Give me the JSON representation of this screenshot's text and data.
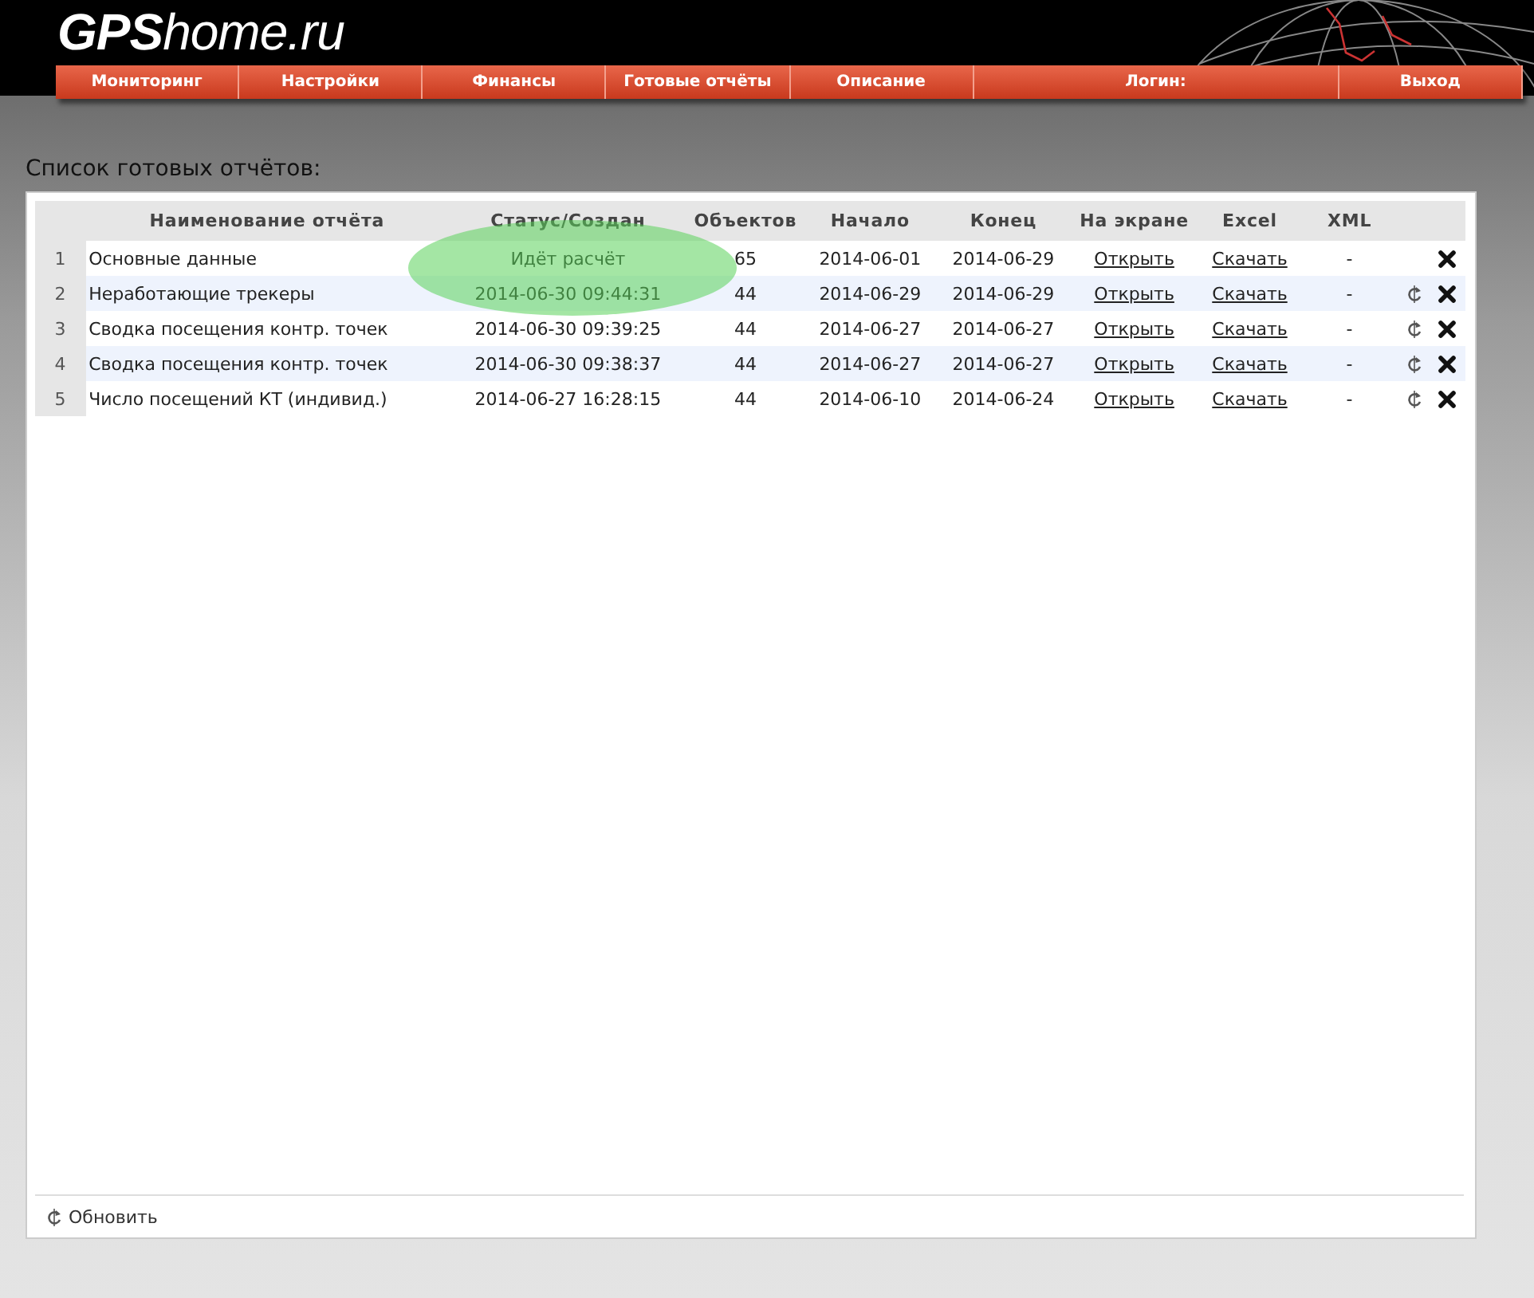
{
  "site": {
    "logo_bold": "GPS",
    "logo_rest": "home.ru"
  },
  "nav": [
    {
      "label": "Мониторинг"
    },
    {
      "label": "Настройки"
    },
    {
      "label": "Финансы"
    },
    {
      "label": "Готовые отчёты"
    },
    {
      "label": "Описание"
    },
    {
      "label": "Логин:",
      "kind": "login"
    },
    {
      "label": "Выход"
    }
  ],
  "page_title": "Список готовых отчётов:",
  "table": {
    "columns": [
      "",
      "Наименование отчёта",
      "Статус/Создан",
      "Объектов",
      "Начало",
      "Конец",
      "На экране",
      "Excel",
      "XML"
    ],
    "rows": [
      {
        "num": "1",
        "name": "Основные данные",
        "status": "Идёт расчёт",
        "objects": "65",
        "start": "2014-06-01",
        "end": "2014-06-29",
        "screen": "Открыть",
        "excel": "Скачать",
        "xml": "-",
        "refresh": false
      },
      {
        "num": "2",
        "name": "Неработающие трекеры",
        "status": "2014-06-30 09:44:31",
        "objects": "44",
        "start": "2014-06-29",
        "end": "2014-06-29",
        "screen": "Открыть",
        "excel": "Скачать",
        "xml": "-",
        "refresh": true
      },
      {
        "num": "3",
        "name": "Сводка посещения контр. точек",
        "status": "2014-06-30 09:39:25",
        "objects": "44",
        "start": "2014-06-27",
        "end": "2014-06-27",
        "screen": "Открыть",
        "excel": "Скачать",
        "xml": "-",
        "refresh": true
      },
      {
        "num": "4",
        "name": "Сводка посещения контр. точек",
        "status": "2014-06-30 09:38:37",
        "objects": "44",
        "start": "2014-06-27",
        "end": "2014-06-27",
        "screen": "Открыть",
        "excel": "Скачать",
        "xml": "-",
        "refresh": true
      },
      {
        "num": "5",
        "name": "Число посещений КТ (индивид.)",
        "status": "2014-06-27 16:28:15",
        "objects": "44",
        "start": "2014-06-10",
        "end": "2014-06-24",
        "screen": "Открыть",
        "excel": "Скачать",
        "xml": "-",
        "refresh": true
      }
    ]
  },
  "footer": {
    "refresh_label": "Обновить"
  }
}
